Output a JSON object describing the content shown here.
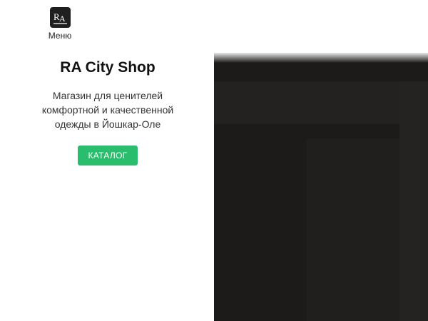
{
  "header": {
    "logo_text": "RA",
    "menu_label": "Меню"
  },
  "hero": {
    "title": "RA City Shop",
    "subtitle": "Магазин для ценителей комфортной и качественной одежды в Йошкар-Оле",
    "catalog_button": "КАТАЛОГ"
  },
  "colors": {
    "accent": "#2bbd6e",
    "logo_bg": "#1f1f1f",
    "image_panel": "#1c1b1a"
  }
}
